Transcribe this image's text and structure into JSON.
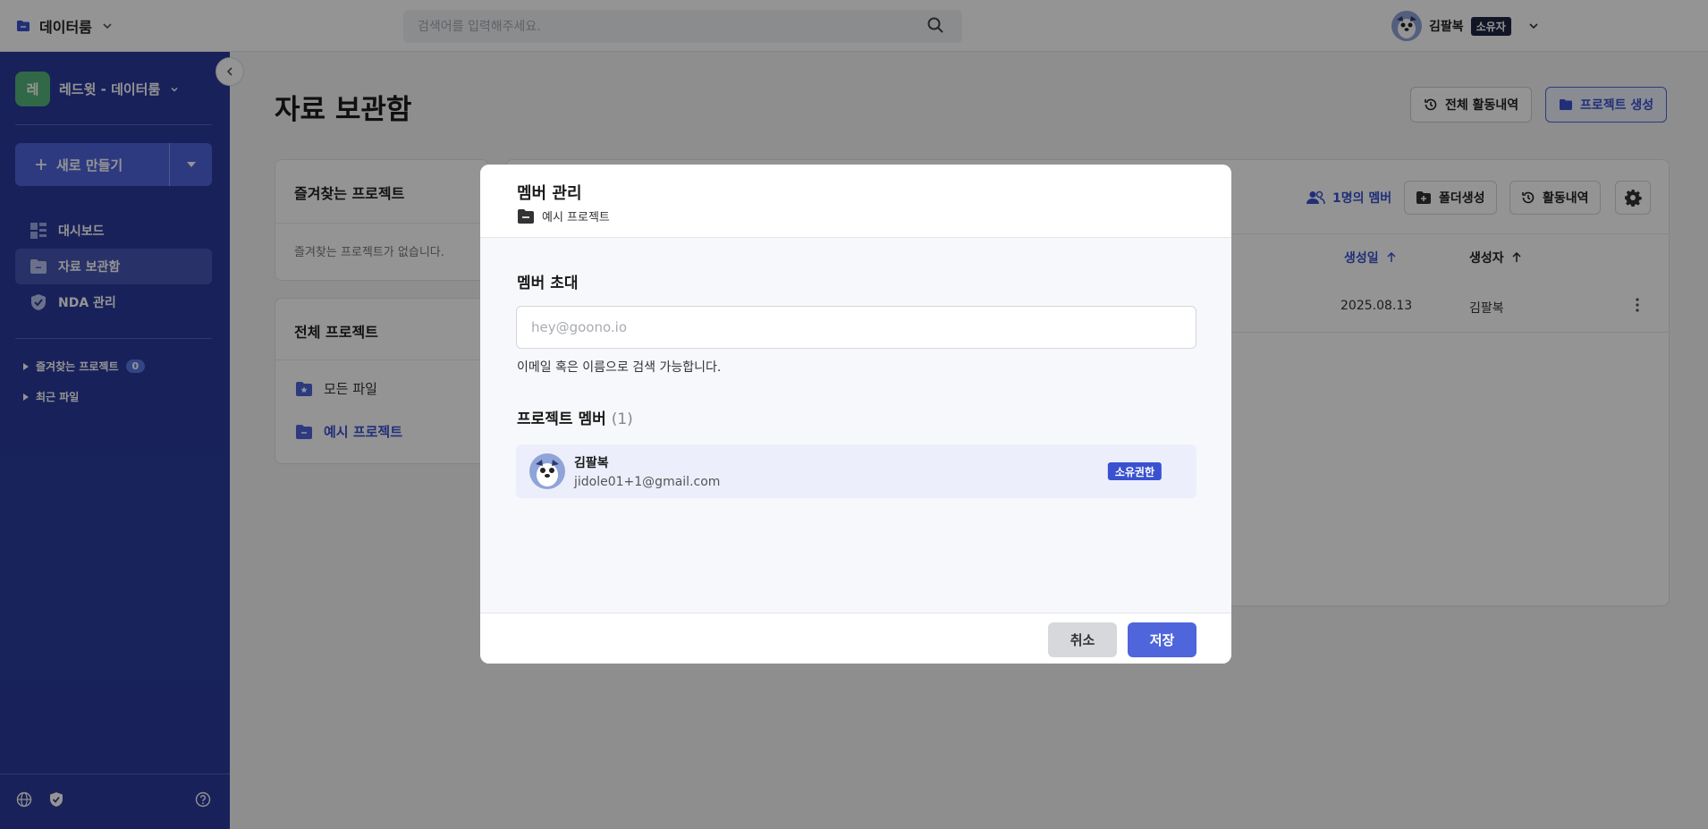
{
  "app": {
    "name": "데이터룸"
  },
  "search": {
    "placeholder": "검색어를 입력해주세요."
  },
  "user": {
    "name": "김팔복",
    "role_badge": "소유자"
  },
  "sidebar": {
    "workspace": {
      "avatar_letter": "레",
      "name": "레드윗 - 데이터룸"
    },
    "new_button": "새로 만들기",
    "items": [
      {
        "label": "대시보드",
        "icon": "dashboard-icon"
      },
      {
        "label": "자료 보관함",
        "icon": "folder-icon",
        "active": true
      },
      {
        "label": "NDA 관리",
        "icon": "shield-icon"
      }
    ],
    "favorites": {
      "label": "즐겨찾는 프로젝트",
      "count": "0"
    },
    "recent": {
      "label": "최근 파일"
    }
  },
  "main": {
    "title": "자료 보관함",
    "header_buttons": {
      "activity_all": "전체 활동내역",
      "create_project": "프로젝트 생성"
    },
    "favorites_card": {
      "title": "즐겨찾는 프로젝트",
      "empty": "즐겨찾는 프로젝트가 없습니다."
    },
    "projects_card": {
      "title": "전체 프로젝트",
      "items": [
        {
          "label": "모든 파일",
          "icon": "starred-folder-icon"
        },
        {
          "label": "예시 프로젝트",
          "icon": "folder-icon",
          "active": true
        }
      ]
    },
    "toolbar": {
      "members": "1명의 멤버",
      "new_folder": "폴더생성",
      "activity": "활동내역"
    },
    "table": {
      "columns": [
        "생성일",
        "생성자"
      ],
      "rows": [
        {
          "created": "2025.08.13",
          "creator": "김팔복"
        }
      ]
    }
  },
  "modal": {
    "title": "멤버 관리",
    "project": "예시 프로젝트",
    "invite": {
      "label": "멤버 초대",
      "placeholder": "hey@goono.io",
      "hint": "이메일 혹은 이름으로 검색 가능합니다."
    },
    "members_section": {
      "label": "프로젝트 멤버",
      "count": "(1)"
    },
    "members": [
      {
        "name": "김팔복",
        "email": "jidole01+1@gmail.com",
        "role": "소유권한"
      }
    ],
    "buttons": {
      "cancel": "취소",
      "save": "저장"
    }
  },
  "colors": {
    "sidebar": "#2a3a9c",
    "accent": "#4e65dc",
    "owner_badge": "#1f2542"
  }
}
